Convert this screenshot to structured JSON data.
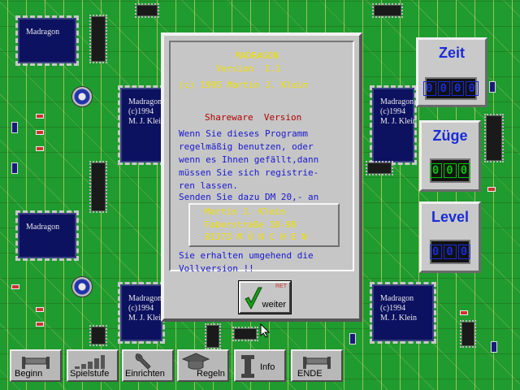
{
  "board": {
    "chips": [
      [
        "Madragon"
      ],
      [
        "Madragon",
        "(c)1994",
        "M. J. Klein"
      ],
      [
        "Madragon"
      ],
      [
        "Madragon",
        "(c)1994",
        "M. J. Klein"
      ],
      [
        "Madragon",
        "(c)1994",
        "M. J. Klein"
      ],
      [
        "Madragon",
        "(c)1994",
        "M. J. Klein"
      ]
    ]
  },
  "panels": {
    "zeit": {
      "title": "Zeit",
      "digits": [
        "0",
        "0",
        "0",
        "0"
      ],
      "color": "#1a2bd8"
    },
    "zuege": {
      "title": "Züge",
      "digits": [
        "0",
        "0",
        "0"
      ],
      "color": "#00c000"
    },
    "level": {
      "title": "Level",
      "digits": [
        "0",
        "0",
        "0"
      ],
      "color": "#1a2bd8"
    }
  },
  "dialog": {
    "app_name": "MADRAGON",
    "version": "Version  1.1",
    "copyright": "(c) 1995 Martin J. Klein",
    "shareware": "Shareware  Version",
    "message": [
      "Wenn Sie dieses Programm",
      "regelmäßig benutzen, oder",
      "wenn es Ihnen gefällt,dann",
      "müssen Sie sich registrie-",
      "ren lassen.",
      "Senden Sie dazu DM 20,- an"
    ],
    "address": [
      "Martin J. Klein",
      "Faberstraße 10-98",
      "81373 M Ü N C H E N"
    ],
    "footer": [
      "Sie erhalten umgehend die",
      "Vollversion !!"
    ],
    "button": {
      "label": "weiter",
      "hotkey": "RET"
    }
  },
  "toolbar": {
    "beginn": "Beginn",
    "spielstufe": "Spielstufe",
    "einrichten": "Einrichten",
    "regeln": "Regeln",
    "info": "Info",
    "ende": "ENDE"
  },
  "colors": {
    "board": "#1f9b2f",
    "dialog": "#c6c6c6",
    "accent_blue": "#1818d0",
    "accent_yellow": "#f0e000",
    "accent_red": "#b00000"
  }
}
